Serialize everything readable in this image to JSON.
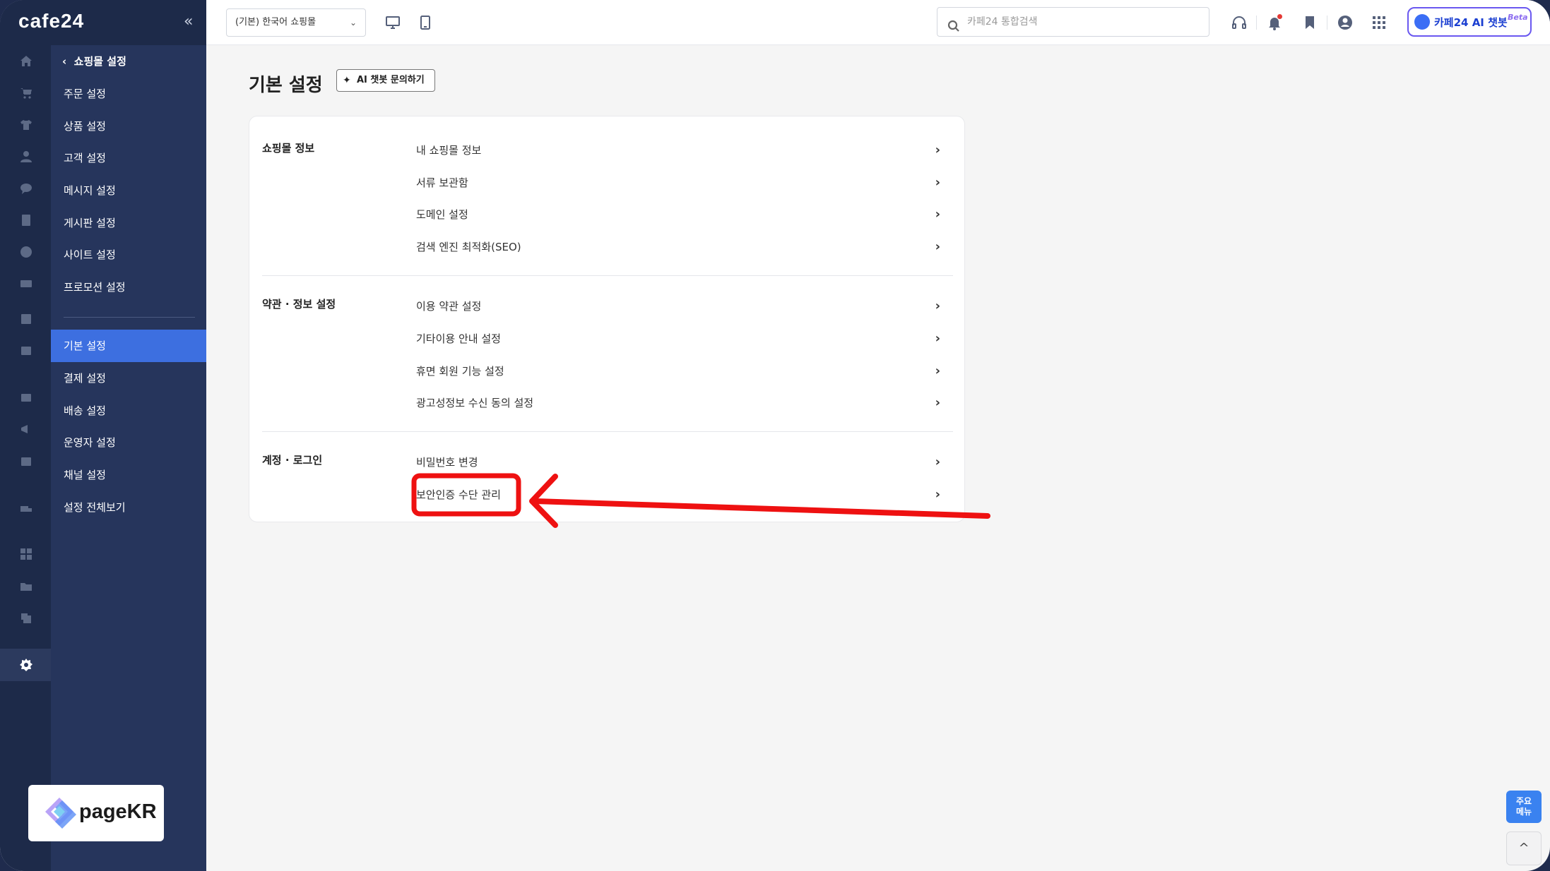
{
  "app": {
    "logo": "cafe24",
    "collapse_icon": "«"
  },
  "rail_icons": [
    "home-icon",
    "cart-icon",
    "shirt-icon",
    "user-icon",
    "chat-icon",
    "board-icon",
    "palette-icon",
    "ticket-icon",
    "chart-icon",
    "design-icon",
    "shop-icon",
    "megaphone-icon",
    "store-icon",
    "truck-icon",
    "apps-icon",
    "folder-icon",
    "copy-icon",
    "gear-icon"
  ],
  "sidebar": {
    "back_label": "쇼핑몰 설정",
    "items": [
      {
        "label": "주문 설정"
      },
      {
        "label": "상품 설정"
      },
      {
        "label": "고객 설정"
      },
      {
        "label": "메시지 설정"
      },
      {
        "label": "게시판 설정"
      },
      {
        "label": "사이트 설정"
      },
      {
        "label": "프로모션 설정"
      },
      {
        "label": "기본 설정"
      },
      {
        "label": "결제 설정"
      },
      {
        "label": "배송 설정"
      },
      {
        "label": "운영자 설정"
      },
      {
        "label": "채널 설정"
      },
      {
        "label": "설정 전체보기"
      }
    ]
  },
  "topbar": {
    "shop_select": "(기본) 한국어 쇼핑몰",
    "search_placeholder": "카페24 통합검색",
    "chatbot_label": "카페24 AI 챗봇",
    "chatbot_beta": "Beta"
  },
  "main": {
    "title": "기본 설정",
    "ai_button": "AI 챗봇 문의하기",
    "sections": [
      {
        "title": "쇼핑몰 정보",
        "links": [
          "내 쇼핑몰 정보",
          "서류 보관함",
          "도메인 설정",
          "검색 엔진 최적화(SEO)"
        ]
      },
      {
        "title": "약관 · 정보 설정",
        "links": [
          "이용 약관 설정",
          "기타이용 안내 설정",
          "휴면 회원 기능 설정",
          "광고성정보 수신 동의 설정"
        ]
      },
      {
        "title": "계정 · 로그인",
        "links": [
          "비밀번호 변경",
          "보안인증 수단 관리"
        ]
      }
    ]
  },
  "badge": {
    "text": "pageKR"
  },
  "floating": {
    "main_menu": "주요\n메뉴",
    "top": "^"
  },
  "colors": {
    "sidebar": "#26355c",
    "rail": "#1d2a49",
    "active": "#3d6fe0",
    "annotation": "#ee1111"
  }
}
